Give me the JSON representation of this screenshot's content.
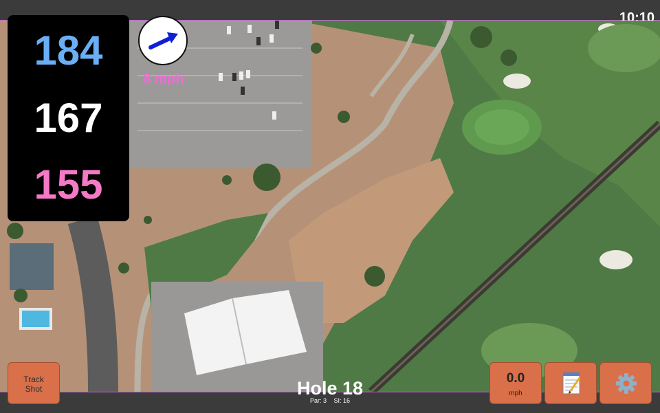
{
  "status_bar": {
    "time": "10:10"
  },
  "distances": {
    "back": "184",
    "middle": "167",
    "front": "155"
  },
  "wind": {
    "speed_label": "8 mph",
    "icon": "wind-direction-arrow-icon"
  },
  "hole": {
    "title": "Hole 18",
    "par_label": "Par: 3",
    "si_label": "SI: 16"
  },
  "buttons": {
    "track_shot": {
      "line1": "Track",
      "line2": "Shot"
    },
    "speed": {
      "value": "0.0",
      "unit": "mph"
    },
    "notes": {
      "icon": "notepad-icon"
    },
    "settings": {
      "icon": "gear-icon"
    }
  },
  "colors": {
    "accent_border": "#c06ad0",
    "button_orange": "#d9704a",
    "back_distance": "#6aaef5",
    "middle_distance": "#ffffff",
    "front_distance": "#f47ac6",
    "wind_label": "#f26ad8"
  }
}
